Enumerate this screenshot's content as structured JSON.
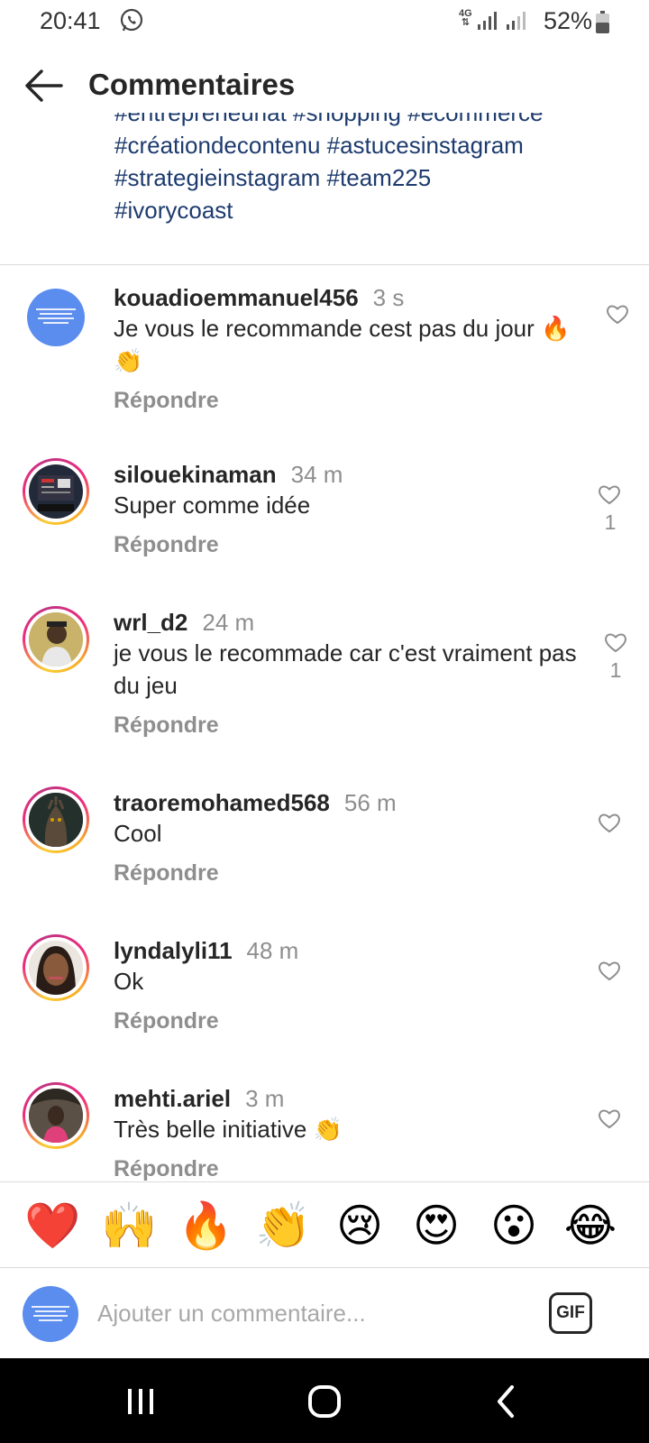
{
  "status_bar": {
    "time": "20:41",
    "network": "4G",
    "battery": "52%"
  },
  "header": {
    "title": "Commentaires"
  },
  "caption": {
    "lines": [
      "#entrepreneuriat #shopping #ecommerce",
      "#créationdecontenu #astucesinstagram",
      "#strategieinstagram #team225",
      "#ivorycoast"
    ]
  },
  "comments": [
    {
      "user": "kouadioemmanuel456",
      "time": "3 s",
      "text": "Je vous le recommande cest pas du jour 🔥👏",
      "reply": "Répondre",
      "likes": ""
    },
    {
      "user": "silouekinaman",
      "time": "34 m",
      "text": "Super comme idée",
      "reply": "Répondre",
      "likes": "1"
    },
    {
      "user": "wrl_d2",
      "time": "24 m",
      "text": "je vous le recommade car c'est vraiment pas du jeu",
      "reply": "Répondre",
      "likes": "1"
    },
    {
      "user": "traoremohamed568",
      "time": "56 m",
      "text": "Cool",
      "reply": "Répondre",
      "likes": ""
    },
    {
      "user": "lyndalyli11",
      "time": "48 m",
      "text": "Ok",
      "reply": "Répondre",
      "likes": ""
    },
    {
      "user": "mehti.ariel",
      "time": "3 m",
      "text": "Très belle initiative 👏",
      "reply": "Répondre",
      "likes": ""
    }
  ],
  "emoji_bar": [
    "❤️",
    "🙌",
    "🔥",
    "👏",
    "😢",
    "😍",
    "😮",
    "😂"
  ],
  "input": {
    "placeholder": "Ajouter un commentaire...",
    "gif_label": "GIF"
  },
  "icons": {
    "whatsapp": "whatsapp-icon",
    "back": "arrow-left-icon",
    "heart": "heart-outline-icon",
    "recents": "recents-icon",
    "home": "home-icon",
    "nav_back": "chevron-left-icon"
  },
  "colors": {
    "hashtag": "#1d3b6e",
    "muted": "#8e8e8e",
    "avatar_blue": "#5b8def"
  }
}
